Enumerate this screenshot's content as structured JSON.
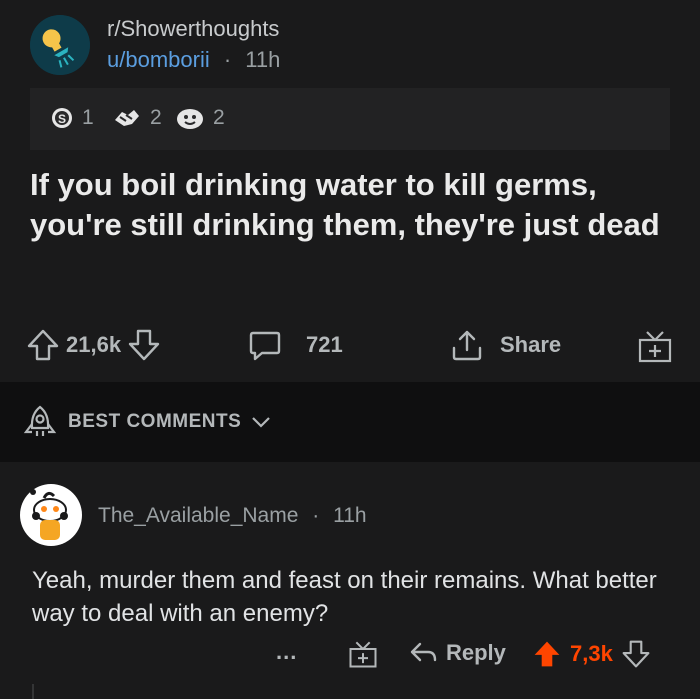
{
  "post": {
    "subreddit": "r/Showerthoughts",
    "username": "u/bomborii",
    "separator": "·",
    "age": "11h",
    "awards": [
      {
        "icon": "silver-award-icon",
        "count": "1"
      },
      {
        "icon": "helpful-award-icon",
        "count": "2"
      },
      {
        "icon": "wholesome-award-icon",
        "count": "2"
      }
    ],
    "title": "If you boil drinking water to kill germs, you're still drinking them, they're just dead",
    "votes": "21,6k",
    "comments_count": "721",
    "share_label": "Share"
  },
  "sort": {
    "label": "BEST COMMENTS"
  },
  "comment": {
    "username": "The_Available_Name",
    "separator": "·",
    "age": "11h",
    "body": "Yeah, murder them and feast on their remains. What better way to deal with an enemy?",
    "more": "...",
    "reply_label": "Reply",
    "votes": "7,3k"
  },
  "colors": {
    "background": "#1a1a1b",
    "upvote_active": "#ff4500",
    "link": "#5b9ee0"
  }
}
